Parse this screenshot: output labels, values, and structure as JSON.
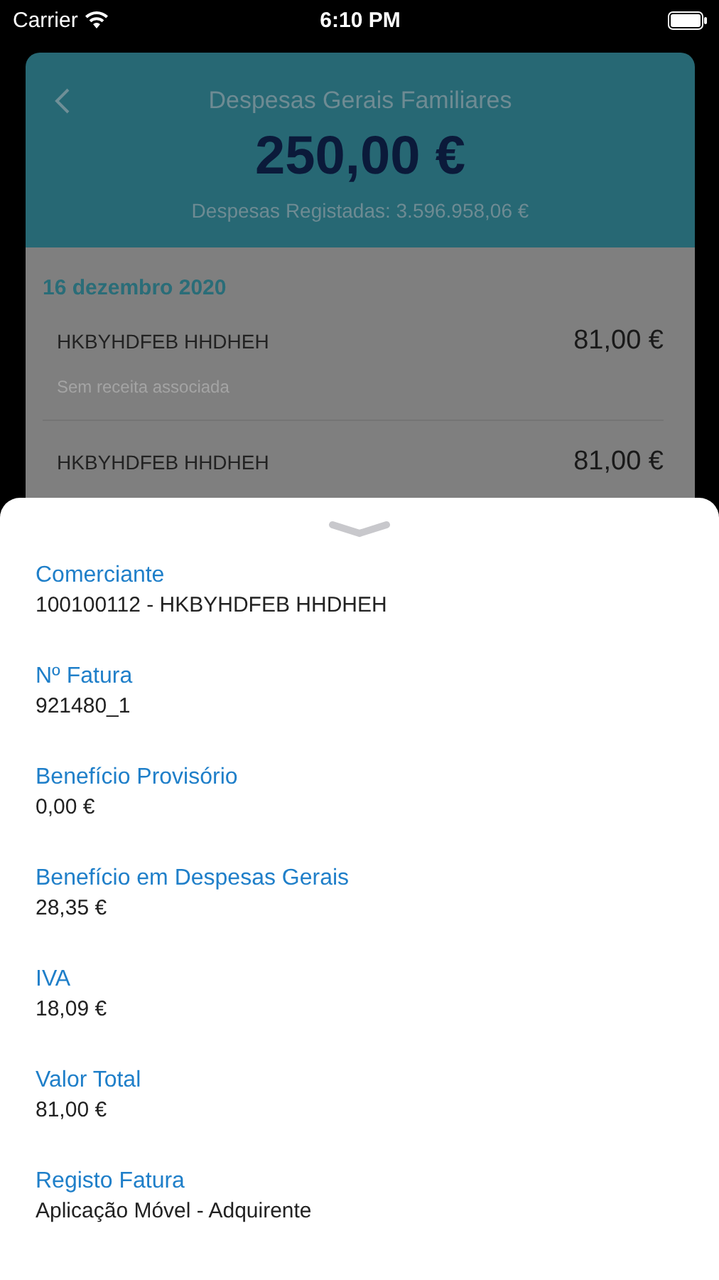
{
  "status_bar": {
    "carrier": "Carrier",
    "time": "6:10 PM"
  },
  "header": {
    "title": "Despesas Gerais Familiares",
    "amount": "250,00 €",
    "subtitle": "Despesas Registadas: 3.596.958,06 €"
  },
  "list": {
    "date": "16 dezembro 2020",
    "rows": [
      {
        "name": "HKBYHDFEB HHDHEH",
        "amount": "81,00 €",
        "note": "Sem receita associada"
      },
      {
        "name": "HKBYHDFEB HHDHEH",
        "amount": "81,00 €"
      }
    ]
  },
  "sheet": {
    "fields": [
      {
        "label": "Comerciante",
        "value": "100100112 - HKBYHDFEB HHDHEH"
      },
      {
        "label": "Nº Fatura",
        "value": "921480_1"
      },
      {
        "label": "Benefício Provisório",
        "value": "0,00 €"
      },
      {
        "label": "Benefício em Despesas Gerais",
        "value": "28,35 €"
      },
      {
        "label": "IVA",
        "value": "18,09 €"
      },
      {
        "label": "Valor Total",
        "value": "81,00 €"
      },
      {
        "label": "Registo Fatura",
        "value": "Aplicação Móvel - Adquirente"
      }
    ]
  }
}
